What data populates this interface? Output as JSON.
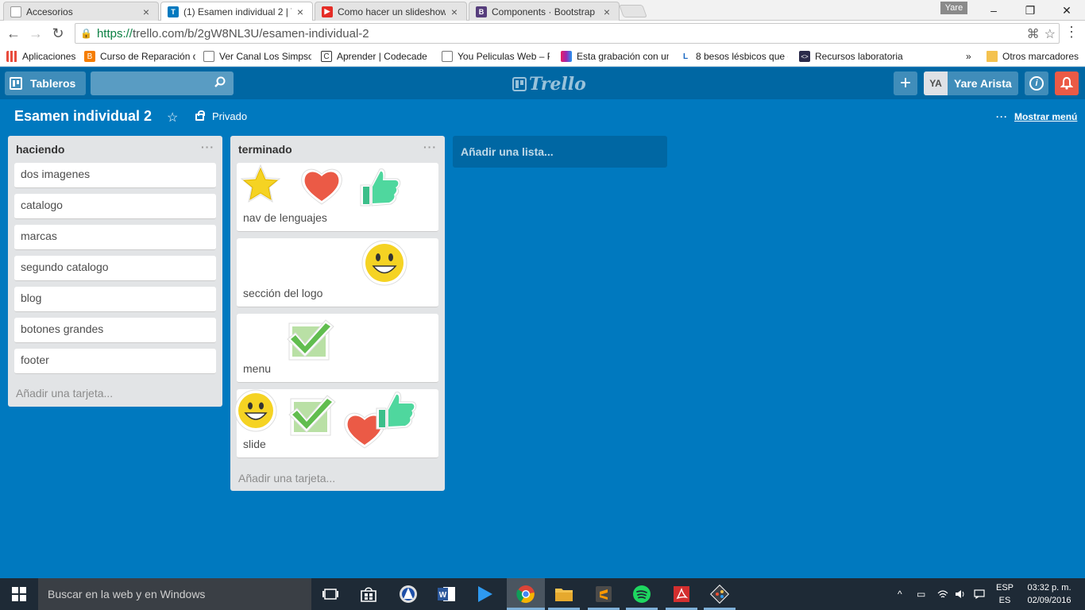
{
  "browser": {
    "tabs": [
      {
        "title": "Accesorios",
        "active": false
      },
      {
        "title": "(1) Esamen individual 2 | T",
        "active": true
      },
      {
        "title": "Como hacer un slideshow",
        "active": false
      },
      {
        "title": "Components · Bootstrap",
        "active": false
      }
    ],
    "profile_name": "Yare",
    "window_controls": {
      "minimize": "–",
      "restore": "❐",
      "close": "✕"
    },
    "url_https": "https://",
    "url_rest": "trello.com/b/2gW8NL3U/esamen-individual-2",
    "bookmarks": [
      {
        "label": "Aplicaciones"
      },
      {
        "label": "Curso de Reparación c"
      },
      {
        "label": "Ver Canal Los Simpso"
      },
      {
        "label": "Aprender | Codecade"
      },
      {
        "label": "You Peliculas Web – P"
      },
      {
        "label": "Esta grabación con un"
      },
      {
        "label": "8 besos lésbicos que d"
      },
      {
        "label": "Recursos laboratoria"
      }
    ],
    "bookmarks_overflow": "»",
    "other_bookmarks": "Otros marcadores"
  },
  "header": {
    "boards_label": "Tableros",
    "search_placeholder": "",
    "logo_text": "Trello",
    "add_label": "+",
    "member_initials": "YA",
    "member_name": "Yare Arista",
    "info_label": "i"
  },
  "board": {
    "title": "Esamen individual 2",
    "star": "☆",
    "privacy": "Privado",
    "menu_dots": "···",
    "show_menu": "Mostrar menú",
    "add_list": "Añadir una lista..."
  },
  "lists": [
    {
      "name": "haciendo",
      "menu": "···",
      "cards": [
        "dos imagenes",
        "catalogo",
        "marcas",
        "segundo catalogo",
        "blog",
        "botones grandes",
        "footer"
      ],
      "add_card": "Añadir una tarjeta..."
    },
    {
      "name": "terminado",
      "menu": "···",
      "cards": [
        {
          "title": "nav de lenguajes",
          "stickers": [
            "star",
            "heart",
            "thumbs-up"
          ]
        },
        {
          "title": "sección del logo",
          "stickers": [
            "smiley"
          ]
        },
        {
          "title": "menu",
          "stickers": [
            "check"
          ]
        },
        {
          "title": "slide",
          "stickers": [
            "smiley",
            "check",
            "heart",
            "thumbs-up"
          ]
        }
      ],
      "add_card": "Añadir una tarjeta..."
    }
  ],
  "taskbar": {
    "search_placeholder": "Buscar en la web y en Windows",
    "lang_line1": "ESP",
    "lang_line2": "ES",
    "time": "03:32 p. m.",
    "date": "02/09/2016"
  },
  "colors": {
    "board_bg": "#0079bf",
    "header_bg": "#0067a3",
    "list_bg": "#e2e4e6",
    "notification": "#eb5a46"
  }
}
